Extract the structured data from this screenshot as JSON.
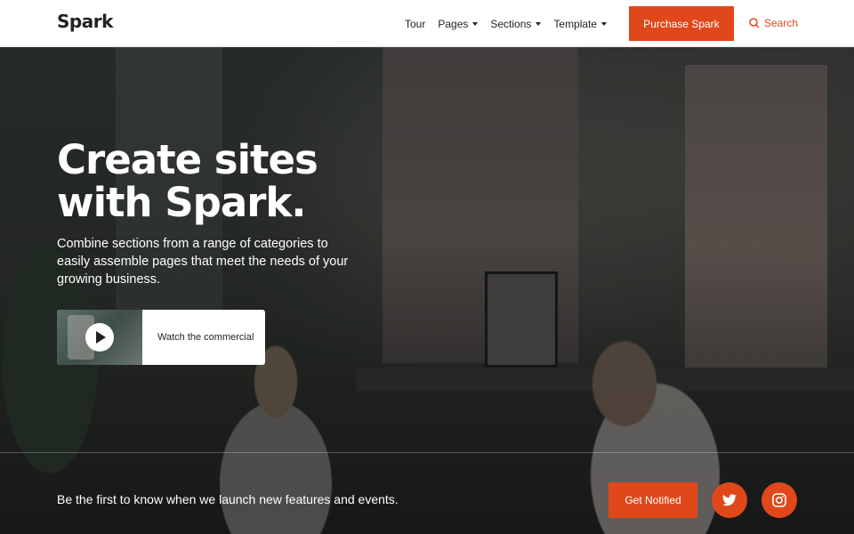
{
  "header": {
    "logo": "Spark",
    "nav": [
      {
        "label": "Tour",
        "dropdown": false
      },
      {
        "label": "Pages",
        "dropdown": true
      },
      {
        "label": "Sections",
        "dropdown": true
      },
      {
        "label": "Template",
        "dropdown": true
      }
    ],
    "purchase_label": "Purchase Spark",
    "search_label": "Search"
  },
  "hero": {
    "title": "Create sites with Spark.",
    "description": "Combine sections from a range of categories to easily assemble pages that meet the needs of your growing business.",
    "video_label": "Watch the commercial"
  },
  "footer": {
    "text": "Be the first to know when we launch new features and events.",
    "notify_label": "Get Notified",
    "social": [
      "twitter-icon",
      "instagram-icon"
    ]
  },
  "colors": {
    "accent": "#e0481c",
    "header_bg": "#ffffff",
    "text_dark": "#222222"
  }
}
